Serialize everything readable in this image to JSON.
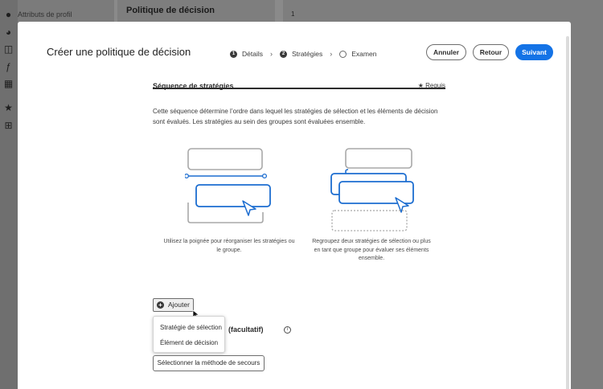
{
  "background": {
    "panel1_label": "Attributs de profil",
    "panel2_title": "Politique de décision",
    "panel3_label": "1"
  },
  "modal": {
    "title": "Créer une politique de décision",
    "steps": [
      {
        "number": "1",
        "label": "Détails"
      },
      {
        "number": "2",
        "label": "Stratégies"
      },
      {
        "number": "",
        "label": "Examen"
      }
    ],
    "buttons": {
      "cancel": "Annuler",
      "back": "Retour",
      "next": "Suivant"
    }
  },
  "section": {
    "title": "Séquence de stratégies",
    "required": "★  Requis",
    "description": "Cette séquence détermine l’ordre dans lequel les stratégies de sélection et les éléments de décision sont évalués. Les stratégies au sein des groupes sont évaluées ensemble.",
    "caption_reorder": "Utilisez la poignée pour réorganiser les stratégies ou le groupe.",
    "caption_group": "Regroupez deux stratégies de sélection ou plus en tant que groupe pour évaluer ses éléments ensemble.",
    "add_button": "Ajouter",
    "menu": [
      "Stratégie de sélection",
      "Élément de décision"
    ],
    "fallback_title": "(facultatif)",
    "fallback_button": "Sélectionner la méthode de secours"
  },
  "colors": {
    "accent": "#1473e6",
    "illustration_blue": "#1c6dd0",
    "illustration_gray": "#a8a8a8"
  }
}
